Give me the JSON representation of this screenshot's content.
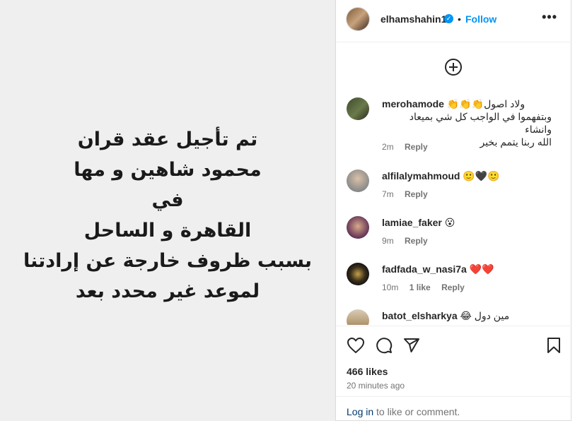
{
  "media": {
    "text": "تم تأجيل عقد قران\nمحمود شاهين و مها\nفي\nالقاهرة و الساحل\nبسبب ظروف خارجة عن إرادتنا\nلموعد غير محدد بعد"
  },
  "header": {
    "username": "elhamshahin1",
    "verified": "✓",
    "dot": "•",
    "follow_label": "Follow",
    "more_label": "•••"
  },
  "comments": [
    {
      "username": "merohamode",
      "text": "👏👏👏ولاد اصول",
      "extra": "وبتفهموا في الواجب كل شي بميعاد وانشاء\nالله ربنا يتمم بخير",
      "time": "2m",
      "likes": "",
      "reply": "Reply"
    },
    {
      "username": "alfilalymahmoud",
      "text": "🙂🖤🙂",
      "extra": "",
      "time": "7m",
      "likes": "",
      "reply": "Reply"
    },
    {
      "username": "lamiae_faker",
      "text": "😮",
      "extra": "",
      "time": "9m",
      "likes": "",
      "reply": "Reply"
    },
    {
      "username": "fadfada_w_nasi7a",
      "text": "❤️❤️",
      "extra": "",
      "time": "10m",
      "likes": "1 like",
      "reply": "Reply"
    },
    {
      "username": "batot_elsharkya",
      "text": "😂 مين دول",
      "extra": "",
      "time": "",
      "likes": "",
      "reply": ""
    }
  ],
  "actions": {
    "icons": [
      "heart-icon",
      "comment-icon",
      "share-icon",
      "bookmark-icon"
    ],
    "likes_count": "466 likes",
    "time_ago": "20 minutes ago"
  },
  "login": {
    "link": "Log in",
    "text": " to like or comment."
  },
  "colors": {
    "accent": "#0095f6",
    "link_dark": "#00376b",
    "muted": "#737373",
    "media_bg": "#efefef"
  }
}
